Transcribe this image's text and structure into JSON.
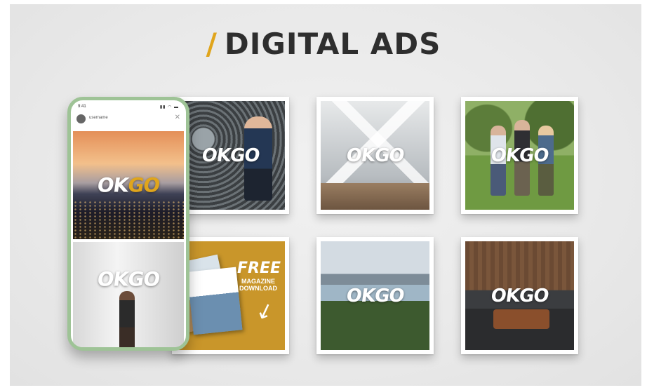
{
  "header": {
    "slash": "/",
    "title": "DIGITAL ADS"
  },
  "brand": {
    "logo_text": "OKGO",
    "logo_part_1": "OK",
    "logo_part_2": "GO",
    "accent_color": "#e0a51c",
    "phone_frame_color": "#9ec396"
  },
  "phone": {
    "status_time": "9:41",
    "status_icons": "▮▮ ◠ ▬",
    "username": "username",
    "close_symbol": "✕"
  },
  "magazine_ad": {
    "headline": "FREE",
    "subline": "MAGAZINE DOWNLOAD"
  },
  "icons": {
    "arrow": "arrow-icon",
    "close": "close-icon",
    "avatar": "avatar"
  }
}
